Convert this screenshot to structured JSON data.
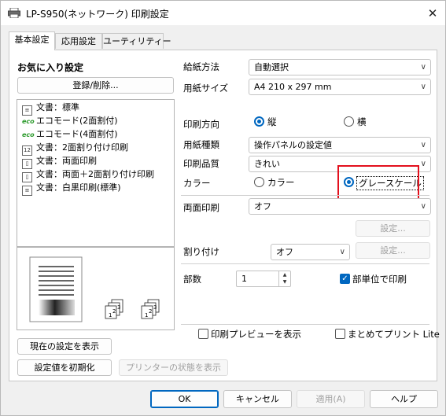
{
  "window": {
    "title": "LP-S950(ネットワーク) 印刷設定",
    "close_icon": "✕"
  },
  "tabs": [
    {
      "label": "基本設定",
      "active": true
    },
    {
      "label": "応用設定",
      "active": false
    },
    {
      "label": "ユーティリティー",
      "active": false
    }
  ],
  "favorites": {
    "heading": "お気に入り設定",
    "register_button": "登録/削除...",
    "items": [
      {
        "icon": "document-icon",
        "label": "文書：標準"
      },
      {
        "icon": "eco-icon",
        "label": "エコモード(2面割付)"
      },
      {
        "icon": "eco-icon",
        "label": "エコモード(4面割付)"
      },
      {
        "icon": "nup-icon",
        "label": "文書：2面割り付け印刷"
      },
      {
        "icon": "duplex-icon",
        "label": "文書：両面印刷"
      },
      {
        "icon": "duplex-nup-icon",
        "label": "文書：両面＋2面割り付け印刷"
      },
      {
        "icon": "document-icon",
        "label": "文書：白黒印刷(標準)"
      }
    ]
  },
  "left_buttons": {
    "show_current": "現在の設定を表示",
    "reset": "設定値を初期化",
    "printer_status": "プリンターの状態を表示"
  },
  "settings": {
    "paper_source": {
      "label": "給紙方法",
      "value": "自動選択"
    },
    "paper_size": {
      "label": "用紙サイズ",
      "value": "A4 210 x 297 mm"
    },
    "orientation": {
      "label": "印刷方向",
      "options": [
        "縦",
        "横"
      ],
      "selected": "縦"
    },
    "paper_type": {
      "label": "用紙種類",
      "value": "操作パネルの設定値"
    },
    "quality": {
      "label": "印刷品質",
      "value": "きれい"
    },
    "color": {
      "label": "カラー",
      "options": [
        "カラー",
        "グレースケール"
      ],
      "selected": "グレースケール"
    },
    "duplex": {
      "label": "両面印刷",
      "value": "オフ",
      "settings_button": "設定..."
    },
    "layout": {
      "label": "割り付け",
      "value": "オフ",
      "settings_button": "設定..."
    },
    "copies": {
      "label": "部数",
      "value": "1"
    },
    "collate": {
      "label": "部単位で印刷",
      "checked": true
    },
    "preview": {
      "label": "印刷プレビューを表示",
      "checked": false
    },
    "batch": {
      "label": "まとめてプリント Lite",
      "checked": false
    }
  },
  "footer": {
    "ok": "OK",
    "cancel": "キャンセル",
    "apply": "適用(A)",
    "help": "ヘルプ"
  },
  "colors": {
    "accent": "#0067c0",
    "highlight_box": "#e3101d"
  }
}
